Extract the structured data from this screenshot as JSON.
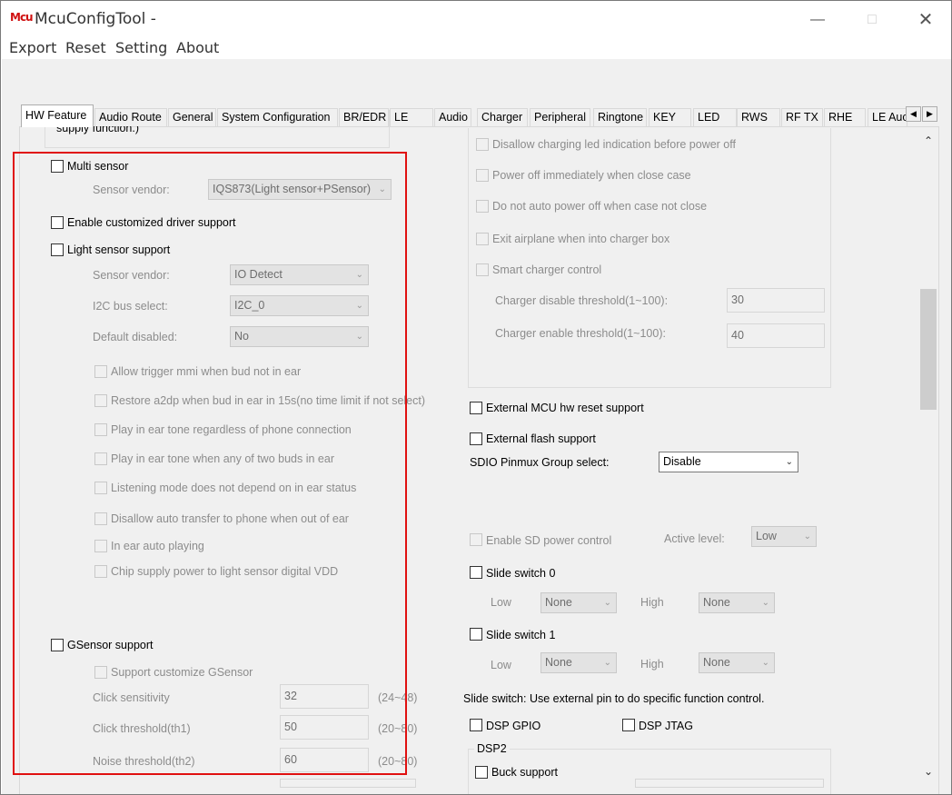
{
  "window": {
    "logo": "Mcu",
    "title": "McuConfigTool -"
  },
  "menu": [
    "Export",
    "Reset",
    "Setting",
    "About"
  ],
  "tabs": [
    "HW Feature",
    "Audio Route",
    "General",
    "System Configuration",
    "BR/EDR",
    "LE",
    "Audio",
    "Charger",
    "Peripheral",
    "Ringtone",
    "KEY",
    "LED",
    "RWS",
    "RF TX",
    "RHE",
    "LE Auc"
  ],
  "left": {
    "clipped_label": "supply function.)",
    "multi_sensor": {
      "label": "Multi sensor",
      "vendor_label": "Sensor vendor:",
      "vendor_value": "IQS873(Light sensor+PSensor)"
    },
    "custom_driver": "Enable customized driver support",
    "light_sensor": {
      "label": "Light sensor support",
      "vendor_label": "Sensor vendor:",
      "vendor_value": "IO Detect",
      "i2c_label": "I2C bus select:",
      "i2c_value": "I2C_0",
      "default_label": "Default disabled:",
      "default_value": "No",
      "options": [
        "Allow trigger mmi when bud not in ear",
        "Restore a2dp when bud in ear in 15s(no time limit if not select)",
        "Play in ear tone regardless of phone connection",
        "Play in ear tone when any of two buds in ear",
        "Listening mode does not depend on in ear status",
        "Disallow auto transfer to phone when out of ear",
        "In ear auto playing",
        "Chip supply power to light sensor digital VDD"
      ]
    },
    "gsensor": {
      "label": "GSensor support",
      "customize": "Support customize GSensor",
      "click_sens_label": "Click sensitivity",
      "click_sens_value": "32",
      "click_sens_range": "(24~48)",
      "click_thr_label": "Click threshold(th1)",
      "click_thr_value": "50",
      "click_thr_range": "(20~80)",
      "noise_thr_label": "Noise threshold(th2)",
      "noise_thr_value": "60",
      "noise_thr_range": "(20~80)"
    }
  },
  "right": {
    "charger_options": [
      "Disallow charging led indication before power off",
      "Power off immediately when close case",
      "Do not auto power off when case not close",
      "Exit airplane when into charger box",
      "Smart charger control"
    ],
    "charger_disable_label": "Charger disable threshold(1~100):",
    "charger_disable_value": "30",
    "charger_enable_label": "Charger enable threshold(1~100):",
    "charger_enable_value": "40",
    "ext_mcu": "External MCU hw reset support",
    "ext_flash": "External flash support",
    "sdio_label": "SDIO Pinmux Group select:",
    "sdio_value": "Disable",
    "sd_power": "Enable SD power control",
    "active_level_label": "Active level:",
    "active_level_value": "Low",
    "slide0": {
      "label": "Slide switch 0",
      "low_label": "Low",
      "low_value": "None",
      "high_label": "High",
      "high_value": "None"
    },
    "slide1": {
      "label": "Slide switch 1",
      "low_label": "Low",
      "low_value": "None",
      "high_label": "High",
      "high_value": "None"
    },
    "slide_note": "Slide switch: Use external pin to do specific function control.",
    "dsp_gpio": "DSP GPIO",
    "dsp_jtag": "DSP JTAG",
    "dsp2_title": "DSP2",
    "buck_support": "Buck support"
  }
}
